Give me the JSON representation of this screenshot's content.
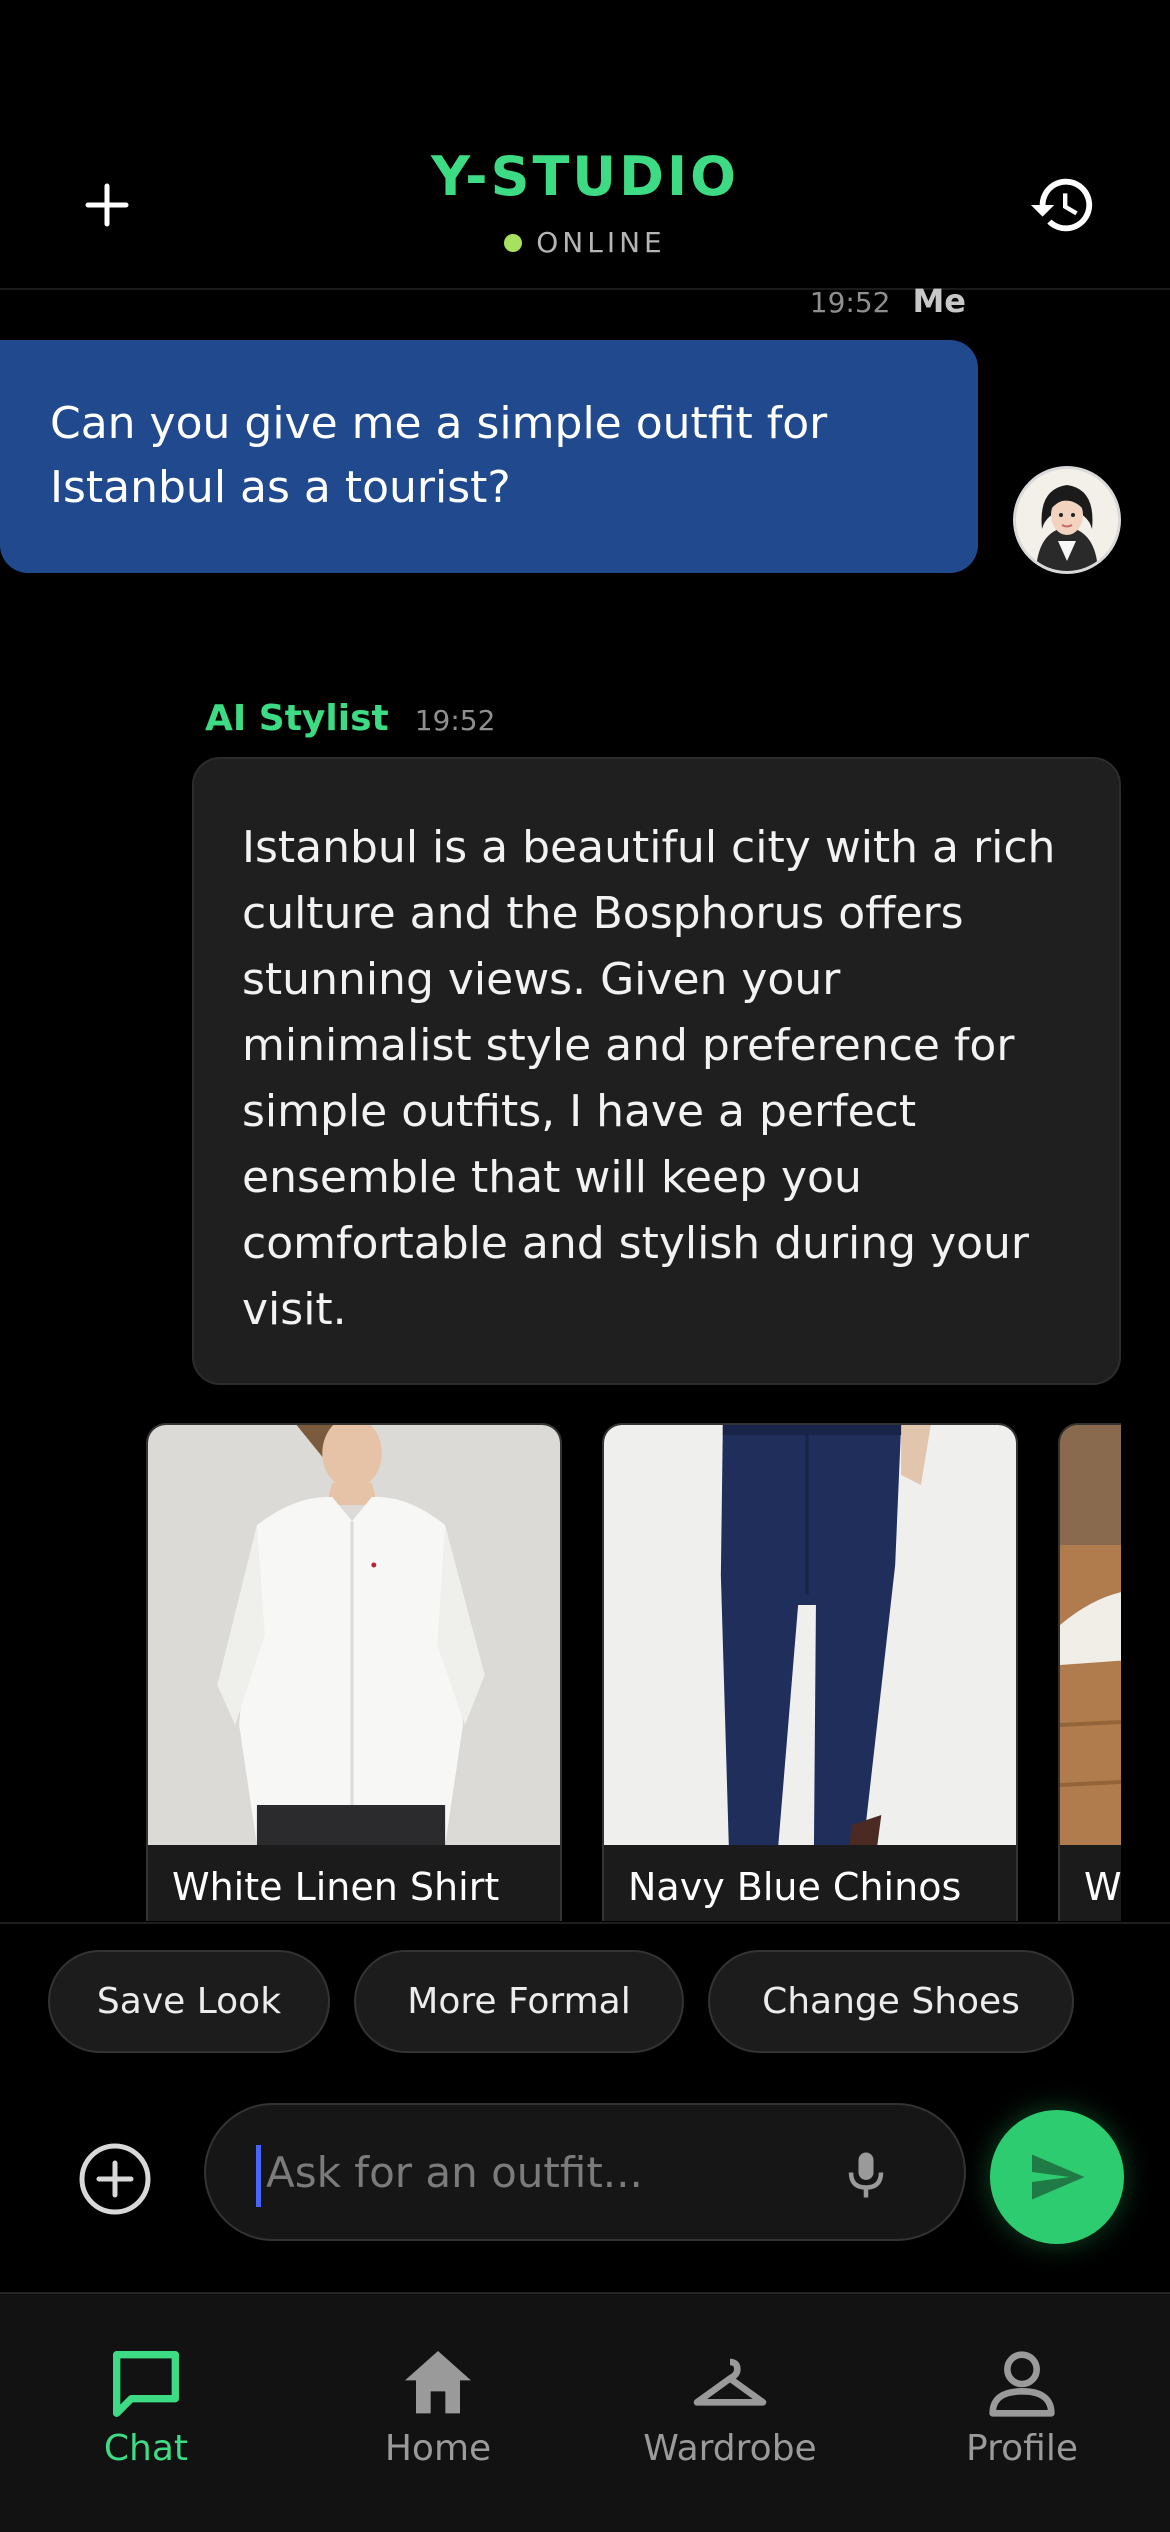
{
  "header": {
    "title": "Y-STUDIO",
    "status": "ONLINE",
    "new_chat_icon": "plus-icon",
    "history_icon": "history-icon"
  },
  "conversation": {
    "user_message": {
      "time": "19:52",
      "sender": "Me",
      "text": "Can you give me a simple outfit for Istanbul as a tourist?"
    },
    "ai_message": {
      "sender": "AI Stylist",
      "time": "19:52",
      "text": "Istanbul is a beautiful city with a rich culture and the Bosphorus offers stunning views. Given your minimalist style and preference for simple outfits, I have a perfect ensemble that will keep you comfortable and stylish during your visit."
    },
    "products": [
      {
        "name": "White Linen Shirt"
      },
      {
        "name": "Navy Blue Chinos"
      },
      {
        "name": "Wh"
      }
    ]
  },
  "quick_actions": [
    "Save Look",
    "More Formal",
    "Change Shoes"
  ],
  "composer": {
    "placeholder": "Ask for an outfit...",
    "value": ""
  },
  "tabs": [
    {
      "label": "Chat",
      "icon": "chat-icon",
      "active": true
    },
    {
      "label": "Home",
      "icon": "home-icon",
      "active": false
    },
    {
      "label": "Wardrobe",
      "icon": "hanger-icon",
      "active": false
    },
    {
      "label": "Profile",
      "icon": "user-icon",
      "active": false
    }
  ],
  "colors": {
    "accent": "#3ddc84",
    "user_bubble": "#214a8e",
    "ai_bubble": "#1f1f1f",
    "send_button": "#2ecc71",
    "status_dot": "#a8e05f"
  }
}
